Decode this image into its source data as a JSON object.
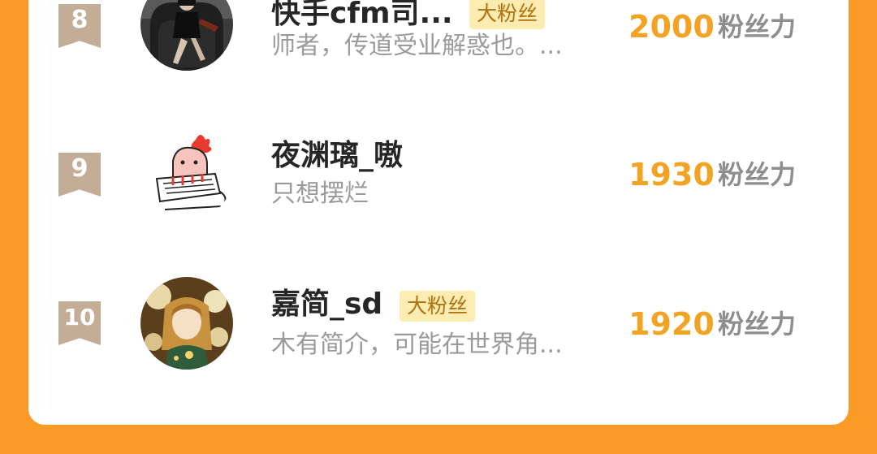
{
  "colors": {
    "background": "#fb9a27",
    "card": "#ffffff",
    "rank_badge": "#c3ad97",
    "score": "#f2a324",
    "fan_badge_bg": "#fdecb2",
    "fan_badge_text": "#b0700c"
  },
  "ranking": [
    {
      "rank": "8",
      "name": "快手cfm司...",
      "badge": "大粉丝",
      "bio": "师者，传道受业解惑也。...",
      "score": "2000",
      "score_unit": "粉丝力",
      "avatar_icon": "avatar-photo-person-in-chair"
    },
    {
      "rank": "9",
      "name": "夜渊璃_嗷",
      "badge": "",
      "bio": "只想摆烂",
      "score": "1930",
      "score_unit": "粉丝力",
      "avatar_icon": "avatar-drawing-creature-keyboard"
    },
    {
      "rank": "10",
      "name": "嘉简_sd",
      "badge": "大粉丝",
      "bio": "木有简介，可能在世界角...",
      "score": "1920",
      "score_unit": "粉丝力",
      "avatar_icon": "avatar-illustration-girl-flowers"
    }
  ]
}
